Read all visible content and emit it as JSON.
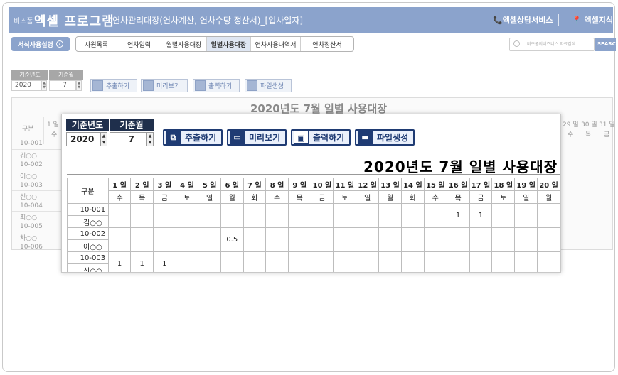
{
  "header": {
    "brand_small": "비즈폼",
    "brand": "엑셀 프로그램",
    "subtitle": "연차관리대장(연차계산, 연차수당 정산서)_[입사일자]",
    "consult": "📞엑셀상담서비스",
    "shop": "📍 엑셀지식 IN"
  },
  "toolbar": {
    "guide_label": "서식사용설명",
    "menu": [
      "사원목록",
      "연차입력",
      "월별사용대장",
      "일별사용대장",
      "연차사용내역서",
      "연차정산서"
    ],
    "active_menu": "일별사용대장",
    "search_placeholder": "비즈폼의비즈니스 자료검색",
    "search_button": "SEARC"
  },
  "controls": {
    "year_label": "기준년도",
    "month_label": "기준월",
    "year": "2020",
    "month": "7",
    "buttons": [
      "추출하기",
      "미리보기",
      "출력하기",
      "파일생성"
    ]
  },
  "sheet": {
    "title": "2020년도 7월 일별 사용대장",
    "label_col": "구분",
    "days": [
      "1 일",
      "2 일",
      "3 일",
      "4 일",
      "5 일",
      "6 일",
      "7 일",
      "8 일",
      "9 일",
      "10 일",
      "11 일",
      "12 일",
      "13 일",
      "14 일",
      "15 일",
      "16 일",
      "17 일",
      "18 일",
      "19 일",
      "20 일"
    ],
    "weekdays": [
      "수",
      "목",
      "금",
      "토",
      "일",
      "월",
      "화",
      "수",
      "목",
      "금",
      "토",
      "일",
      "월",
      "화",
      "수",
      "목",
      "금",
      "토",
      "일",
      "월"
    ],
    "employees": [
      {
        "code": "10-001",
        "name": "김○○",
        "values": [
          "",
          "",
          "",
          "",
          "",
          "",
          "",
          "",
          "",
          "",
          "",
          "",
          "",
          "",
          "",
          "1",
          "1",
          "",
          "",
          ""
        ]
      },
      {
        "code": "10-002",
        "name": "이○○",
        "values": [
          "",
          "",
          "",
          "",
          "",
          "0.5",
          "",
          "",
          "",
          "",
          "",
          "",
          "",
          "",
          "",
          "",
          "",
          "",
          "",
          ""
        ]
      },
      {
        "code": "10-003",
        "name": "신○○",
        "values": [
          "1",
          "1",
          "1",
          "",
          "",
          "",
          "",
          "",
          "",
          "",
          "",
          "",
          "",
          "",
          "",
          "",
          "",
          "",
          "",
          ""
        ]
      }
    ]
  },
  "background": {
    "title": "2020년도 7월 일별 사용대장",
    "label_col": "구분",
    "row_labels": [
      "10-001",
      "김○○",
      "10-002",
      "이○○",
      "10-003",
      "신○○",
      "10-004",
      "최○○",
      "10-005",
      "차○○",
      "10-006"
    ],
    "left_day": "1 일",
    "left_weekday": "수",
    "right_days": [
      "29 일",
      "30 일",
      "31 일"
    ],
    "right_weekdays": [
      "수",
      "목",
      "금"
    ]
  },
  "colors": {
    "header_bg": "#8ba3cc",
    "control_head": "#1f2f4c",
    "button_border": "#1f3b73",
    "saturday": "#1f4db5",
    "sunday": "#d02020"
  }
}
